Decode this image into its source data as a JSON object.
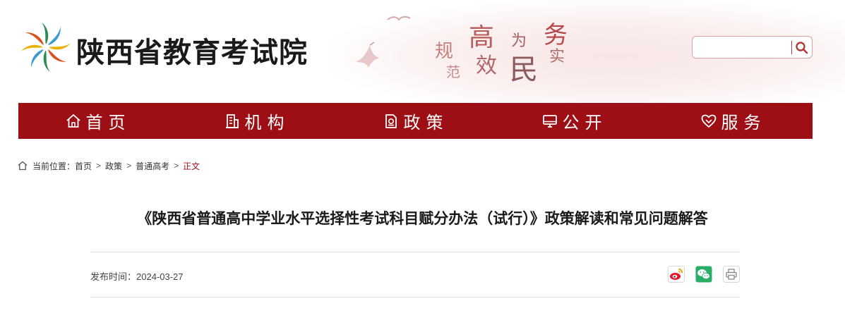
{
  "header": {
    "site_name": "陕西省教育考试院",
    "slogan_chars": [
      "规",
      "高",
      "为",
      "务",
      "范",
      "效",
      "民",
      "实"
    ],
    "search": {
      "placeholder": "",
      "value": ""
    }
  },
  "nav": {
    "items": [
      {
        "label": "首页",
        "icon": "home-icon"
      },
      {
        "label": "机构",
        "icon": "building-icon"
      },
      {
        "label": "政策",
        "icon": "document-icon"
      },
      {
        "label": "公开",
        "icon": "monitor-icon"
      },
      {
        "label": "服务",
        "icon": "heart-service-icon"
      }
    ]
  },
  "breadcrumb": {
    "prefix": "当前位置：",
    "items": [
      "首页",
      "政策",
      "普通高考"
    ],
    "current": "正文",
    "separator": ">"
  },
  "article": {
    "title": "《陕西省普通高中学业水平选择性考试科目赋分办法（试行）》政策解读和常见问题解答",
    "publish_label": "发布时间：",
    "publish_date": "2024-03-27"
  },
  "share": [
    "weibo-icon",
    "wechat-icon",
    "print-icon"
  ],
  "colors": {
    "brand": "#9e0f15",
    "accent_light": "#f8e6e6"
  }
}
